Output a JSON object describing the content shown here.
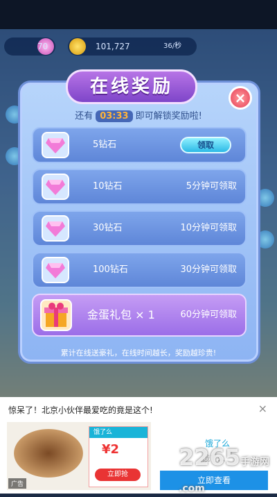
{
  "topbar": {
    "gems": "70",
    "coins": "101,727",
    "coin_rate": "36/秒"
  },
  "modal": {
    "title": "在线奖励",
    "close_label": "×",
    "countdown_prefix": "还有",
    "countdown_time": "03:33",
    "countdown_suffix": "即可解锁奖励啦!",
    "rows": [
      {
        "label": "5钻石",
        "action": "领取"
      },
      {
        "label": "10钻石",
        "status": "5分钟可领取"
      },
      {
        "label": "30钻石",
        "status": "10分钟可领取"
      },
      {
        "label": "100钻石",
        "status": "30分钟可领取"
      }
    ],
    "gift_row": {
      "label": "金蛋礼包 × 1",
      "status": "60分钟可领取"
    },
    "footnote": "累计在线送豪礼，在线时间越长，奖励越珍贵!"
  },
  "ad": {
    "title": "惊呆了！北京小伙伴最爱吃的竟是这个!",
    "close_icon": "×",
    "ticket_brand": "饿了么",
    "ticket_amount": "¥2",
    "ticket_button": "立即抢",
    "tag": "广告",
    "brand": "饿了么",
    "brand_name": "饿了么",
    "cta": "立即查看"
  },
  "watermark": {
    "main": "2265",
    "sub": "手游网",
    "domain": ".com"
  },
  "colors": {
    "accent_purple": "#7e45c9",
    "close_red": "#e63d56",
    "timer_orange": "#ffb43a"
  }
}
